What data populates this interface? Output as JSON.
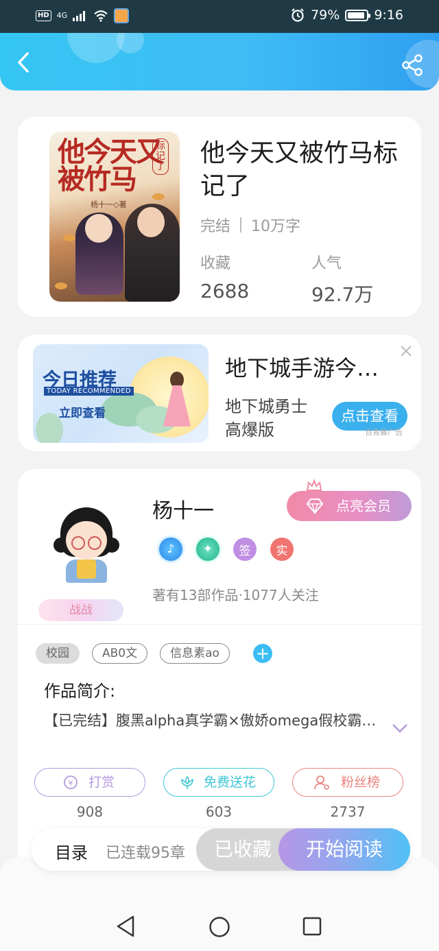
{
  "status_bar": {
    "hd": "HD",
    "network": "4G",
    "battery": "79%",
    "battery_level": 0.79,
    "time": "9:16"
  },
  "header": {
    "back_icon": "back-arrow-icon",
    "share_icon": "share-icon"
  },
  "book": {
    "cover_title": "他今天又被竹马",
    "cover_tag": "标记了",
    "cover_author": "杨十一◇著",
    "title": "他今天又被竹马标记了",
    "status": "完结",
    "word_count": "10万字",
    "favorites_label": "收藏",
    "favorites_value": "2688",
    "popularity_label": "人气",
    "popularity_value": "92.7万"
  },
  "ad": {
    "banner_title": "今日推荐",
    "banner_english": "TODAY RECOMMENDED",
    "banner_cta": "立即查看",
    "title": "地下城手游今…",
    "description": "地下城勇士高爆版",
    "button": "点击查看",
    "source": "百青藤广告"
  },
  "author": {
    "name": "杨十一",
    "battle_badge": "战战",
    "vip_button": "点亮会员",
    "badge_sign": "签",
    "badge_real": "实",
    "works_info": "著有13部作品·1077人关注"
  },
  "tags": [
    "校园",
    "AB0文",
    "信息素ao"
  ],
  "intro": {
    "label": "作品简介:",
    "text": "【已完结】腹黑alpha真学霸×傲娇omega假校霸…"
  },
  "actions": {
    "tip_label": "打赏",
    "tip_count": "908",
    "flower_label": "免费送花",
    "flower_count": "603",
    "fans_label": "粉丝榜",
    "fans_count": "2737"
  },
  "reading_bar": {
    "toc": "目录",
    "chapters": "已连载95章",
    "favorited": "已收藏",
    "start_reading": "开始阅读"
  },
  "colors": {
    "header_blue": "#3fbdf5",
    "accent_blue": "#3bb0ee",
    "tip_purple": "#b39ae0",
    "flower_teal": "#3fc6d6",
    "fans_red": "#e9847f"
  }
}
